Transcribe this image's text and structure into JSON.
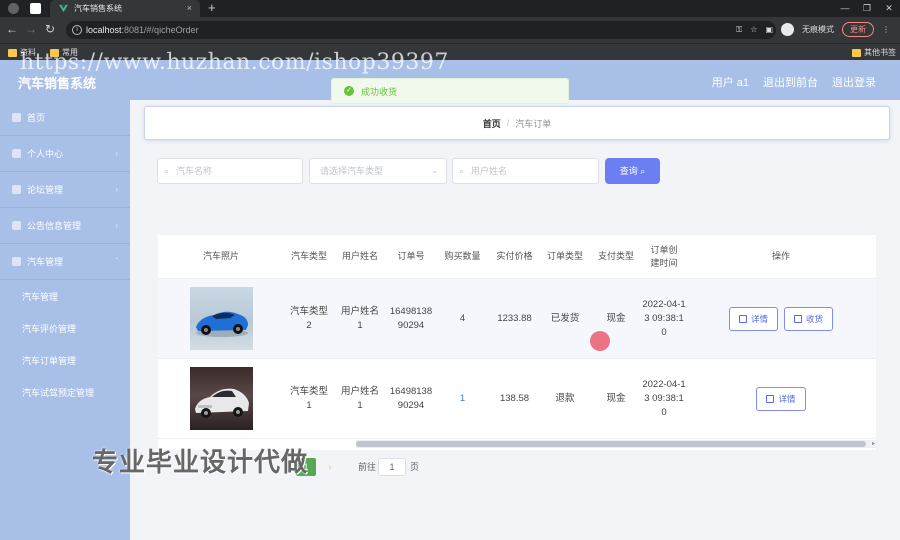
{
  "browser": {
    "tab_title": "汽车销售系统",
    "tab_close": "×",
    "new_tab": "+",
    "url_host": "localhost",
    "url_rest": ":8081/#/qicheOrder",
    "incognito_label": "无痕模式",
    "update_label": "更新",
    "bookmarks": [
      "资料",
      "常用"
    ],
    "other_bookmarks": "其他书签"
  },
  "app": {
    "title": "汽车销售系统",
    "header_links": [
      "用户 a1",
      "退出到前台",
      "退出登录"
    ]
  },
  "sidebar": {
    "items": [
      {
        "label": "首页",
        "icon": "home-icon"
      },
      {
        "label": "个人中心",
        "icon": "user-icon"
      },
      {
        "label": "论坛管理",
        "icon": "forum-icon"
      },
      {
        "label": "公告信息管理",
        "icon": "notice-icon"
      },
      {
        "label": "汽车管理",
        "icon": "car-icon"
      }
    ],
    "sub_items": [
      "汽车管理",
      "汽车评价管理",
      "汽车订单管理",
      "汽车试驾预定管理"
    ]
  },
  "toast": {
    "message": "成功收货"
  },
  "breadcrumb": {
    "home": "首页",
    "current": "汽车订单"
  },
  "search": {
    "car_name_placeholder": "汽车名称",
    "car_type_placeholder": "请选择汽车类型",
    "user_name_placeholder": "用户姓名",
    "button": "查询"
  },
  "table": {
    "headers": [
      "汽车照片",
      "汽车类型",
      "用户姓名",
      "订单号",
      "购买数量",
      "实付价格",
      "订单类型",
      "支付类型",
      "订单创建时间",
      "操作"
    ],
    "rows": [
      {
        "car_type": "汽车类型2",
        "user_name": "用户姓名1",
        "order_no": "1649813890294",
        "quantity": "4",
        "price": "1233.88",
        "order_type": "已发货",
        "pay_type": "现金",
        "created": "2022-04-13 09:38:10",
        "actions": [
          "详情",
          "收货"
        ]
      },
      {
        "car_type": "汽车类型1",
        "user_name": "用户姓名1",
        "order_no": "1649813890294",
        "quantity": "1",
        "price": "138.58",
        "order_type": "退款",
        "pay_type": "现金",
        "created": "2022-04-13 09:38:10",
        "actions": [
          "详情"
        ]
      }
    ]
  },
  "pagination": {
    "current": "1",
    "goto_label": "前往",
    "goto_value": "1",
    "page_suffix": "页"
  },
  "watermarks": {
    "url": "https://www.huzhan.com/ishop39397",
    "cn": "专业毕业设计代做"
  }
}
